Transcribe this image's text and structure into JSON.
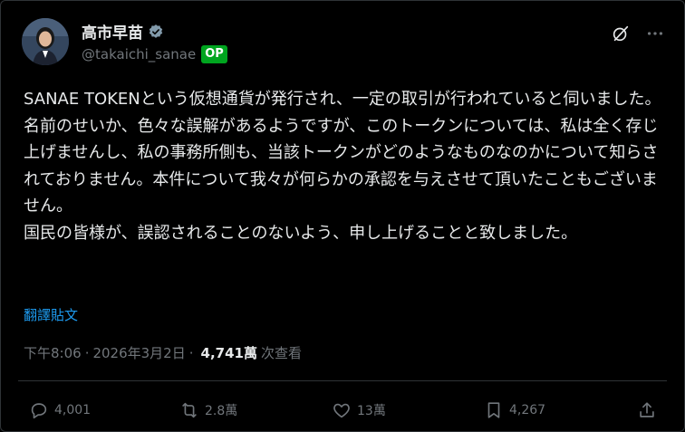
{
  "author": {
    "display_name": "高市早苗",
    "handle": "@takaichi_sanae",
    "badge": "OP"
  },
  "post": {
    "text": "SANAE TOKENという仮想通貨が発行され、一定の取引が行われていると伺いました。\n名前のせいか、色々な誤解があるようですが、このトークンについては、私は全く存じ上げませんし、私の事務所側も、当該トークンがどのようなものなのかについて知らされておりません。本件について我々が何らかの承認を与えさせて頂いたこともございません。\n国民の皆様が、誤認されることのないよう、申し上げることと致しました。",
    "translate_label": "翻譯貼文"
  },
  "meta": {
    "time": "下午8:06",
    "date": "2026年3月2日",
    "separator": "·",
    "views_count": "4,741萬",
    "views_label": "次查看"
  },
  "actions": {
    "replies": "4,001",
    "reposts": "2.8萬",
    "likes": "13萬",
    "bookmarks": "4,267"
  },
  "colors": {
    "background": "#000000",
    "text": "#e7e9ea",
    "muted": "#71767b",
    "link": "#1d9bf0",
    "verified": "#829aab",
    "op_badge": "#00a51f"
  },
  "icons": [
    "verified-badge-icon",
    "grok-icon",
    "more-icon",
    "reply-icon",
    "repost-icon",
    "like-icon",
    "bookmark-icon",
    "share-icon"
  ]
}
